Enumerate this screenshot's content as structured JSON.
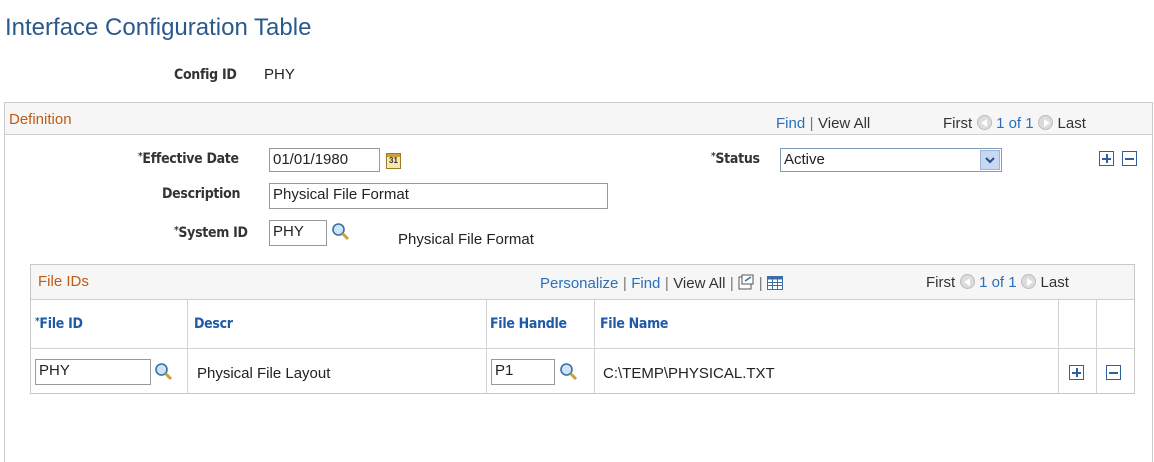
{
  "page": {
    "title": "Interface Configuration Table"
  },
  "config": {
    "label": "Config ID",
    "value": "PHY"
  },
  "definition": {
    "title": "Definition",
    "find": "Find",
    "view_all": "View All",
    "first": "First",
    "range": "1 of 1",
    "last": "Last",
    "effective_date_label": "Effective Date",
    "effective_date": "01/01/1980",
    "status_label": "Status",
    "status": "Active",
    "description_label": "Description",
    "description": "Physical File Format",
    "system_id_label": "System ID",
    "system_id": "PHY",
    "system_id_desc": "Physical File Format",
    "required_mark": "*",
    "calendar_text": "31"
  },
  "file_ids": {
    "title": "File IDs",
    "personalize": "Personalize",
    "find": "Find",
    "view_all": "View All",
    "first": "First",
    "range": "1 of 1",
    "last": "Last",
    "columns": {
      "file_id": "File ID",
      "descr": "Descr",
      "file_handle": "File Handle",
      "file_name": "File Name"
    },
    "rows": [
      {
        "file_id": "PHY",
        "descr": "Physical File Layout",
        "file_handle": "P1",
        "file_name": "C:\\TEMP\\PHYSICAL.TXT"
      }
    ]
  }
}
